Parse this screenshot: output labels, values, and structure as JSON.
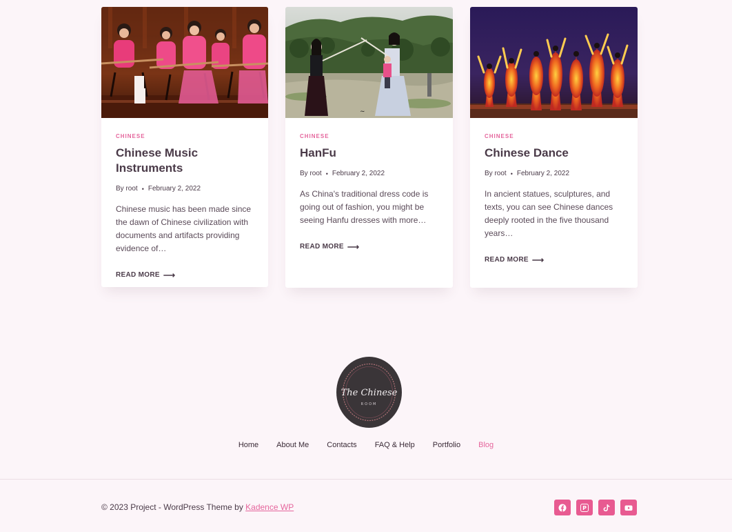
{
  "posts": [
    {
      "category": "CHINESE",
      "title_lines": [
        "Chinese Music",
        "Instruments"
      ],
      "author": "By root",
      "date": "February 2, 2022",
      "excerpt_lines": [
        "Chinese music has been made since",
        "the dawn of Chinese civilization with",
        "documents and artifacts providing",
        "evidence of…"
      ],
      "read_more": "READ MORE"
    },
    {
      "category": "CHINESE",
      "title_lines": [
        "HanFu"
      ],
      "author": "By root",
      "date": "February 2, 2022",
      "excerpt_lines": [
        "As China's traditional dress code is",
        "going out of fashion, you might be",
        "seeing Hanfu dresses with more…"
      ],
      "read_more": "READ MORE"
    },
    {
      "category": "CHINESE",
      "title_lines": [
        "Chinese Dance"
      ],
      "author": "By root",
      "date": "February 2, 2022",
      "excerpt_lines": [
        "In ancient statues, sculptures, and",
        "texts, you can see Chinese dances",
        "deeply rooted in the five thousand",
        "years…"
      ],
      "read_more": "READ MORE"
    }
  ],
  "logo": {
    "script": "The Chinese",
    "sub": "ROOM"
  },
  "footer_nav": [
    "Home",
    "About Me",
    "Contacts",
    "FAQ & Help",
    "Portfolio",
    "Blog"
  ],
  "footer_nav_active": "Blog",
  "copyright": {
    "text": "© 2023 Project - WordPress Theme by ",
    "link": "Kadence WP"
  },
  "social": [
    "facebook-icon",
    "pinterest-icon",
    "tiktok-icon",
    "youtube-icon"
  ],
  "colors": {
    "accent": "#e5659c",
    "social_bg": "#e85a91",
    "page_bg": "#fcf5f9",
    "logo_bg": "#3a3538"
  }
}
